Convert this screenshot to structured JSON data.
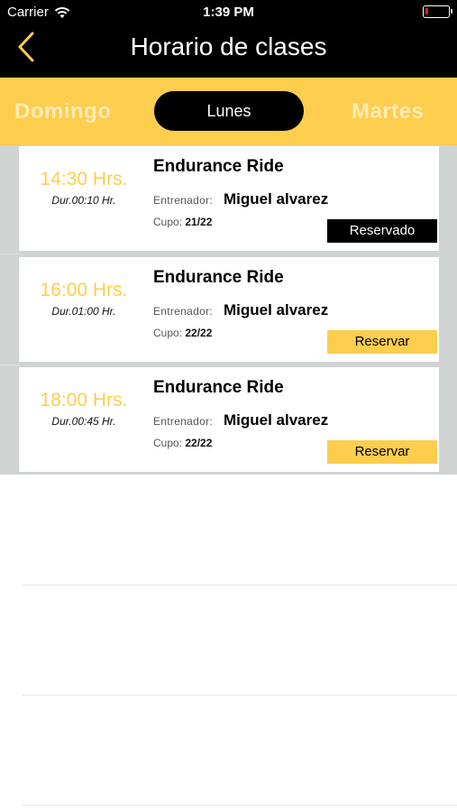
{
  "status": {
    "carrier": "Carrier",
    "time": "1:39 PM",
    "battery_color": "#e0211d"
  },
  "nav": {
    "title": "Horario de clases",
    "back_icon": "chevron-left-icon"
  },
  "days": {
    "prev": "Domingo",
    "current": "Lunes",
    "next": "Martes"
  },
  "colors": {
    "accent": "#fdcd4d",
    "dark": "#000000"
  },
  "classes": [
    {
      "time": "14:30 Hrs.",
      "duration": "Dur.00:10 Hr.",
      "name": "Endurance Ride",
      "trainer_label": "Entrenador:",
      "trainer": "Miguel alvarez",
      "cupo_label": "Cupo:",
      "cupo": "21/22",
      "action": "Reservado"
    },
    {
      "time": "16:00 Hrs.",
      "duration": "Dur.01:00 Hr.",
      "name": "Endurance Ride",
      "trainer_label": "Entrenador:",
      "trainer": "Miguel alvarez",
      "cupo_label": "Cupo:",
      "cupo": "22/22",
      "action": "Reservar"
    },
    {
      "time": "18:00 Hrs.",
      "duration": "Dur.00:45 Hr.",
      "name": "Endurance Ride",
      "trainer_label": "Entrenador:",
      "trainer": "Miguel alvarez",
      "cupo_label": "Cupo:",
      "cupo": "22/22",
      "action": "Reservar"
    }
  ]
}
